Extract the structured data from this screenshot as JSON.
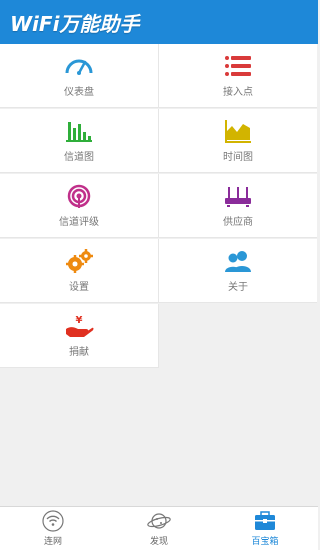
{
  "app": {
    "title": "WiFi万能助手"
  },
  "menu": [
    {
      "label": "仪表盘",
      "icon": "speedometer-icon",
      "color": "#2a97d6"
    },
    {
      "label": "接入点",
      "icon": "access-point-list-icon",
      "color": "#d93a3a"
    },
    {
      "label": "信道图",
      "icon": "bar-chart-icon",
      "color": "#2fae3a"
    },
    {
      "label": "时间图",
      "icon": "area-chart-icon",
      "color": "#d2b400"
    },
    {
      "label": "信道评级",
      "icon": "signal-rating-icon",
      "color": "#c0308a"
    },
    {
      "label": "供应商",
      "icon": "router-icon",
      "color": "#8a2c9a"
    },
    {
      "label": "设置",
      "icon": "gears-icon",
      "color": "#ee8a10"
    },
    {
      "label": "关于",
      "icon": "users-icon",
      "color": "#2a97d6"
    },
    {
      "label": "捐献",
      "icon": "donate-hand-icon",
      "color": "#e03020"
    }
  ],
  "tabs": [
    {
      "label": "连网",
      "icon": "wifi-icon",
      "active": false
    },
    {
      "label": "发现",
      "icon": "planet-icon",
      "active": false
    },
    {
      "label": "百宝箱",
      "icon": "toolbox-icon",
      "active": true
    }
  ],
  "colors": {
    "header": "#1e88d8",
    "active_tab": "#1e88d8"
  }
}
